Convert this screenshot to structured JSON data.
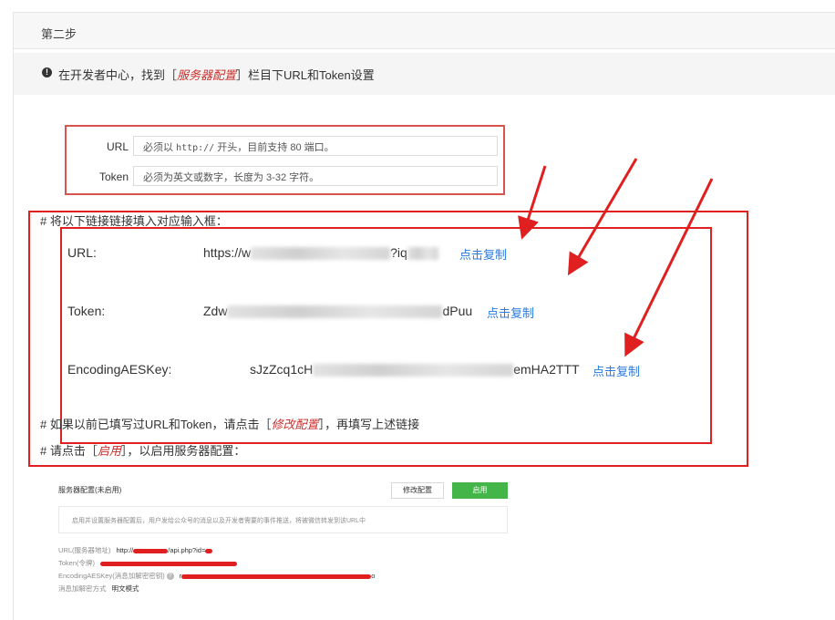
{
  "step": {
    "title": "第二步"
  },
  "info": {
    "prefix": "在开发者中心，找到［",
    "highlight": "服务器配置",
    "suffix": "］栏目下URL和Token设置"
  },
  "form": {
    "url_label": "URL",
    "url_placeholder_prefix": "必须以",
    "url_placeholder_code": "http://",
    "url_placeholder_suffix": "开头，目前支持 80 端口。",
    "token_label": "Token",
    "token_placeholder": "必须为英文或数字，长度为 3-32 字符。"
  },
  "instructions": {
    "fill_line": "# 将以下链接链接填入对应输入框：",
    "url_label": "URL:",
    "url_value_start": "https://w",
    "url_value_end": "?iq",
    "token_label": "Token:",
    "token_value_start": "Zdw",
    "token_value_end": "dPuu",
    "aes_label": "EncodingAESKey:",
    "aes_value_start": "sJzZcq1cH",
    "aes_value_end": "emHA2TTT",
    "copy_label": "点击复制",
    "modify_line_prefix": "# 如果以前已填写过URL和Token，请点击［",
    "modify_line_highlight": "修改配置",
    "modify_line_suffix": "］，再填写上述链接",
    "enable_line_prefix": "# 请点击［",
    "enable_line_highlight": "启用",
    "enable_line_suffix": "］，以启用服务器配置："
  },
  "config_card": {
    "title": "服务器配置(未启用)",
    "modify_button": "修改配置",
    "enable_button": "启用",
    "description": "启用并设置服务器配置后，用户发给公众号的消息以及开发者需要的事件推送，将被微信转发到该URL中",
    "url_label": "URL(服务器地址)",
    "url_value_start": "http://",
    "url_value_end": "/api.php?id=",
    "token_label": "Token(令牌)",
    "aes_label": "EncodingAESKey(消息加解密密钥)",
    "aes_help_icon": "?",
    "aes_value_start": "r",
    "aes_value_end": "o",
    "mode_label": "消息加解密方式",
    "mode_value": "明文模式"
  },
  "colors": {
    "annotation_red": "#e02020",
    "link_blue": "#2a7ae2",
    "enable_green": "#44b549"
  }
}
